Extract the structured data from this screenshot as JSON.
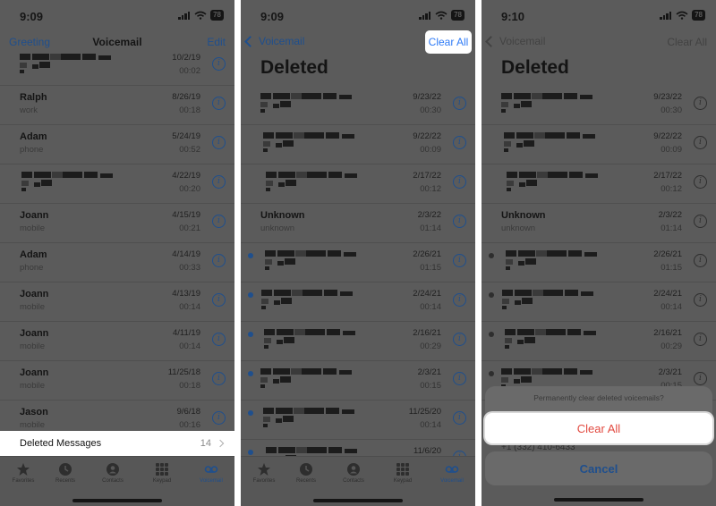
{
  "panel1": {
    "time": "9:09",
    "battery": "78",
    "nav": {
      "left": "Greeting",
      "title": "Voicemail",
      "right": "Edit"
    },
    "rows": [
      {
        "name": "",
        "sub": "",
        "date": "10/2/19",
        "dur": "00:02",
        "blur": true,
        "dot": false
      },
      {
        "name": "Ralph",
        "sub": "work",
        "date": "8/26/19",
        "dur": "00:18",
        "blur": false,
        "dot": false
      },
      {
        "name": "Adam",
        "sub": "phone",
        "date": "5/24/19",
        "dur": "00:52",
        "blur": false,
        "dot": false
      },
      {
        "name": "",
        "sub": "",
        "date": "4/22/19",
        "dur": "00:20",
        "blur": true,
        "dot": false
      },
      {
        "name": "Joann",
        "sub": "mobile",
        "date": "4/15/19",
        "dur": "00:21",
        "blur": false,
        "dot": false
      },
      {
        "name": "Adam",
        "sub": "phone",
        "date": "4/14/19",
        "dur": "00:33",
        "blur": false,
        "dot": false
      },
      {
        "name": "Joann",
        "sub": "mobile",
        "date": "4/13/19",
        "dur": "00:14",
        "blur": false,
        "dot": false
      },
      {
        "name": "Joann",
        "sub": "mobile",
        "date": "4/11/19",
        "dur": "00:14",
        "blur": false,
        "dot": false
      },
      {
        "name": "Joann",
        "sub": "mobile",
        "date": "11/25/18",
        "dur": "00:18",
        "blur": false,
        "dot": false
      },
      {
        "name": "Jason",
        "sub": "mobile",
        "date": "9/6/18",
        "dur": "00:16",
        "blur": false,
        "dot": false
      }
    ],
    "deleted_label": "Deleted Messages",
    "deleted_count": "14"
  },
  "panel2": {
    "time": "9:09",
    "battery": "78",
    "nav": {
      "back": "Voicemail",
      "right": "Clear All"
    },
    "title": "Deleted",
    "rows": [
      {
        "name": "",
        "sub": "",
        "date": "9/23/22",
        "dur": "00:30",
        "blur": true,
        "dot": false
      },
      {
        "name": "",
        "sub": "",
        "date": "9/22/22",
        "dur": "00:09",
        "blur": true,
        "dot": false
      },
      {
        "name": "",
        "sub": "",
        "date": "2/17/22",
        "dur": "00:12",
        "blur": true,
        "dot": false
      },
      {
        "name": "Unknown",
        "sub": "unknown",
        "date": "2/3/22",
        "dur": "01:14",
        "blur": false,
        "dot": false
      },
      {
        "name": "",
        "sub": "",
        "date": "2/26/21",
        "dur": "01:15",
        "blur": true,
        "dot": true
      },
      {
        "name": "",
        "sub": "",
        "date": "2/24/21",
        "dur": "00:14",
        "blur": true,
        "dot": true
      },
      {
        "name": "",
        "sub": "",
        "date": "2/16/21",
        "dur": "00:29",
        "blur": true,
        "dot": true
      },
      {
        "name": "",
        "sub": "",
        "date": "2/3/21",
        "dur": "00:15",
        "blur": true,
        "dot": true
      },
      {
        "name": "",
        "sub": "",
        "date": "11/25/20",
        "dur": "00:14",
        "blur": true,
        "dot": true
      },
      {
        "name": "",
        "sub": "",
        "date": "11/6/20",
        "dur": "",
        "blur": true,
        "dot": true
      }
    ]
  },
  "panel3": {
    "time": "9:10",
    "battery": "78",
    "nav": {
      "back": "Voicemail",
      "right": "Clear All"
    },
    "title": "Deleted",
    "rows": [
      {
        "name": "",
        "sub": "",
        "date": "9/23/22",
        "dur": "00:30",
        "blur": true,
        "dot": false
      },
      {
        "name": "",
        "sub": "",
        "date": "9/22/22",
        "dur": "00:09",
        "blur": true,
        "dot": false
      },
      {
        "name": "",
        "sub": "",
        "date": "2/17/22",
        "dur": "00:12",
        "blur": true,
        "dot": false
      },
      {
        "name": "Unknown",
        "sub": "unknown",
        "date": "2/3/22",
        "dur": "01:14",
        "blur": false,
        "dot": false
      },
      {
        "name": "",
        "sub": "",
        "date": "2/26/21",
        "dur": "01:15",
        "blur": true,
        "dot": true
      },
      {
        "name": "",
        "sub": "",
        "date": "2/24/21",
        "dur": "00:14",
        "blur": true,
        "dot": true
      },
      {
        "name": "",
        "sub": "",
        "date": "2/16/21",
        "dur": "00:29",
        "blur": true,
        "dot": true
      },
      {
        "name": "",
        "sub": "",
        "date": "2/3/21",
        "dur": "00:15",
        "blur": true,
        "dot": true
      }
    ],
    "sheet": {
      "message": "Permanently clear deleted voicemails?",
      "clear": "Clear All",
      "cancel": "Cancel",
      "under_text": "+1 (332) 410-6433"
    }
  },
  "tabs": [
    "Favorites",
    "Recents",
    "Contacts",
    "Keypad",
    "Voicemail"
  ],
  "colors": {
    "accent": "#1f4f8d",
    "highlight": "#2f7bf6",
    "destructive": "#e24a40"
  }
}
